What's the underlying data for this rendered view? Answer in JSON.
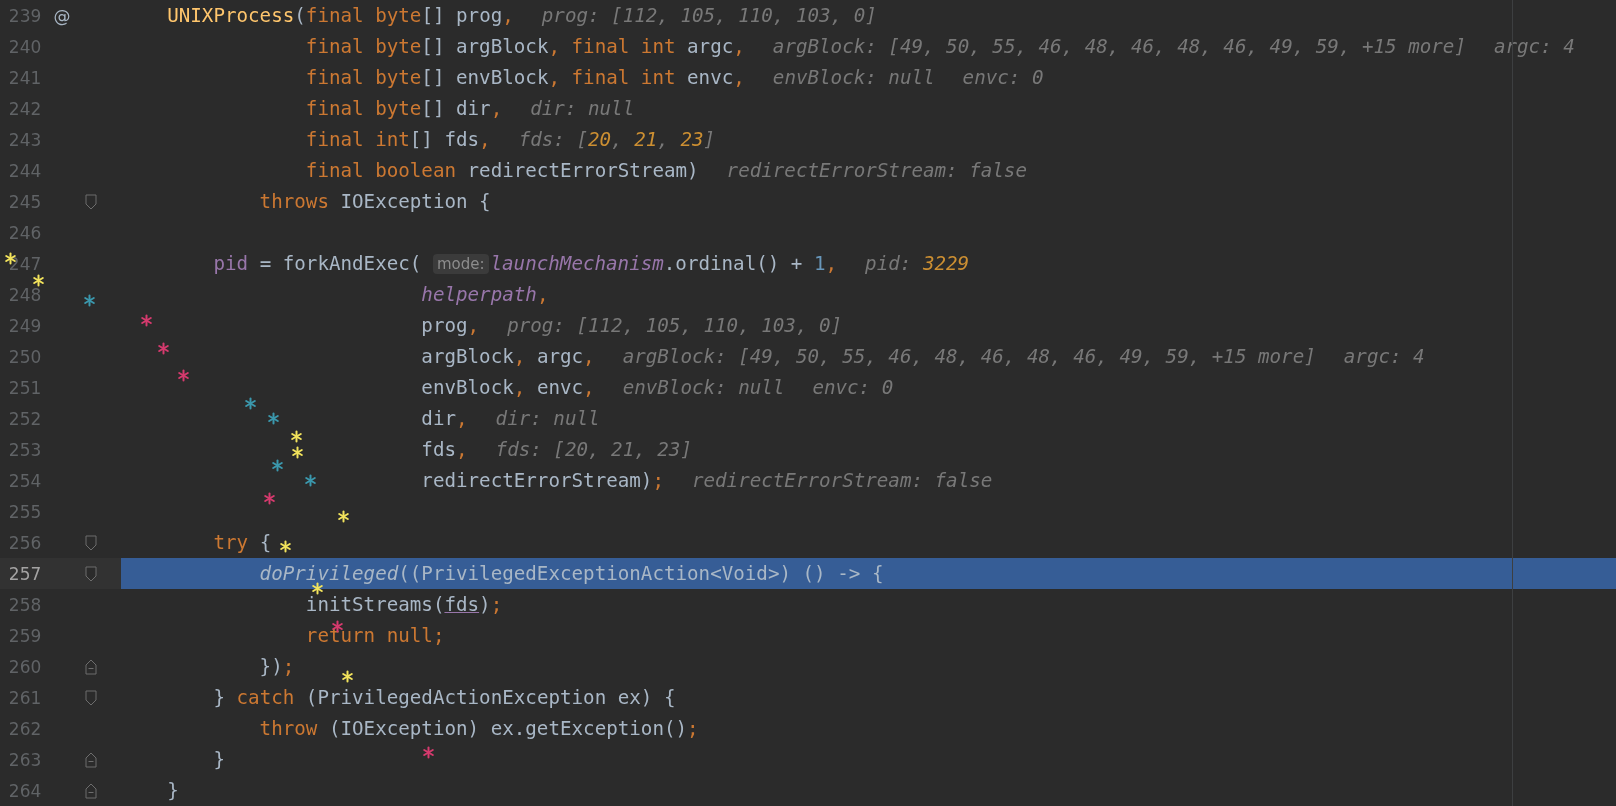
{
  "editor": {
    "lines": [
      {
        "number": "239",
        "selected": false,
        "gutter_mark": "@",
        "code": [
          {
            "kind": "decl",
            "text": "    UNIXProcess"
          },
          {
            "kind": "plain",
            "text": "("
          },
          {
            "kind": "kw",
            "text": "final byte"
          },
          {
            "kind": "plain",
            "text": "[] prog"
          },
          {
            "kind": "kw",
            "text": ","
          }
        ],
        "hints": [
          {
            "segments": [
              {
                "kind": "label",
                "text": "prog: [112, 105, 110, 103, 0]"
              }
            ]
          }
        ]
      },
      {
        "number": "240",
        "selected": false,
        "code": [
          {
            "kind": "kw",
            "text": "                final byte"
          },
          {
            "kind": "plain",
            "text": "[] argBlock"
          },
          {
            "kind": "kw",
            "text": ", final int "
          },
          {
            "kind": "plain",
            "text": "argc"
          },
          {
            "kind": "kw",
            "text": ","
          }
        ],
        "hints": [
          {
            "segments": [
              {
                "kind": "label",
                "text": "argBlock: [49, 50, 55, 46, 48, 46, 48, 46, 49, 59, +15 more]"
              }
            ]
          },
          {
            "segments": [
              {
                "kind": "label",
                "text": "argc: 4"
              }
            ]
          }
        ]
      },
      {
        "number": "241",
        "selected": false,
        "code": [
          {
            "kind": "kw",
            "text": "                final byte"
          },
          {
            "kind": "plain",
            "text": "[] envBlock"
          },
          {
            "kind": "kw",
            "text": ", final int "
          },
          {
            "kind": "plain",
            "text": "envc"
          },
          {
            "kind": "kw",
            "text": ","
          }
        ],
        "hints": [
          {
            "segments": [
              {
                "kind": "label",
                "text": "envBlock: null"
              }
            ]
          },
          {
            "segments": [
              {
                "kind": "label",
                "text": "envc: 0"
              }
            ]
          }
        ]
      },
      {
        "number": "242",
        "selected": false,
        "code": [
          {
            "kind": "kw",
            "text": "                final byte"
          },
          {
            "kind": "plain",
            "text": "[] dir"
          },
          {
            "kind": "kw",
            "text": ","
          }
        ],
        "hints": [
          {
            "segments": [
              {
                "kind": "label",
                "text": "dir: null"
              }
            ]
          }
        ]
      },
      {
        "number": "243",
        "selected": false,
        "code": [
          {
            "kind": "kw",
            "text": "                final int"
          },
          {
            "kind": "plain",
            "text": "[] fds"
          },
          {
            "kind": "kw",
            "text": ","
          }
        ],
        "hints": [
          {
            "segments": [
              {
                "kind": "label",
                "text": "fds: ["
              },
              {
                "kind": "value",
                "text": "20"
              },
              {
                "kind": "label",
                "text": ", "
              },
              {
                "kind": "value",
                "text": "21"
              },
              {
                "kind": "label",
                "text": ", "
              },
              {
                "kind": "value",
                "text": "23"
              },
              {
                "kind": "label",
                "text": "]"
              }
            ]
          }
        ]
      },
      {
        "number": "244",
        "selected": false,
        "code": [
          {
            "kind": "kw",
            "text": "                final boolean "
          },
          {
            "kind": "plain",
            "text": "redirectErrorStream)"
          }
        ],
        "hints": [
          {
            "segments": [
              {
                "kind": "label",
                "text": "redirectErrorStream: false"
              }
            ]
          }
        ]
      },
      {
        "number": "245",
        "selected": false,
        "fold": {
          "kind": "start"
        },
        "code": [
          {
            "kind": "kw",
            "text": "            throws "
          },
          {
            "kind": "plain",
            "text": "IOException {"
          }
        ]
      },
      {
        "number": "246",
        "selected": false
      },
      {
        "number": "247",
        "selected": false,
        "code": [
          {
            "kind": "member",
            "text": "        pid"
          },
          {
            "kind": "plain",
            "text": " = forkAndExec( "
          },
          {
            "kind": "inlay",
            "text": "mode:"
          },
          {
            "kind": "field",
            "text": "launchMechanism"
          },
          {
            "kind": "plain",
            "text": ".ordinal() + "
          },
          {
            "kind": "num",
            "text": "1"
          },
          {
            "kind": "kw",
            "text": ","
          }
        ],
        "hints": [
          {
            "segments": [
              {
                "kind": "label",
                "text": "pid: "
              },
              {
                "kind": "value",
                "text": "3229"
              }
            ]
          }
        ]
      },
      {
        "number": "248",
        "selected": false,
        "code": [
          {
            "kind": "field",
            "text": "                          helperpath"
          },
          {
            "kind": "kw",
            "text": ","
          }
        ]
      },
      {
        "number": "249",
        "selected": false,
        "code": [
          {
            "kind": "plain",
            "text": "                          prog"
          },
          {
            "kind": "kw",
            "text": ","
          }
        ],
        "hints": [
          {
            "segments": [
              {
                "kind": "label",
                "text": "prog: [112, 105, 110, 103, 0]"
              }
            ]
          }
        ]
      },
      {
        "number": "250",
        "selected": false,
        "code": [
          {
            "kind": "plain",
            "text": "                          argBlock"
          },
          {
            "kind": "kw",
            "text": ", "
          },
          {
            "kind": "plain",
            "text": "argc"
          },
          {
            "kind": "kw",
            "text": ","
          }
        ],
        "hints": [
          {
            "segments": [
              {
                "kind": "label",
                "text": "argBlock: [49, 50, 55, 46, 48, 46, 48, 46, 49, 59, +15 more]"
              }
            ]
          },
          {
            "segments": [
              {
                "kind": "label",
                "text": "argc: 4"
              }
            ]
          }
        ]
      },
      {
        "number": "251",
        "selected": false,
        "code": [
          {
            "kind": "plain",
            "text": "                          envBlock"
          },
          {
            "kind": "kw",
            "text": ", "
          },
          {
            "kind": "plain",
            "text": "envc"
          },
          {
            "kind": "kw",
            "text": ","
          }
        ],
        "hints": [
          {
            "segments": [
              {
                "kind": "label",
                "text": "envBlock: null"
              }
            ]
          },
          {
            "segments": [
              {
                "kind": "label",
                "text": "envc: 0"
              }
            ]
          }
        ]
      },
      {
        "number": "252",
        "selected": false,
        "code": [
          {
            "kind": "plain",
            "text": "                          dir"
          },
          {
            "kind": "kw",
            "text": ","
          }
        ],
        "hints": [
          {
            "segments": [
              {
                "kind": "label",
                "text": "dir: null"
              }
            ]
          }
        ]
      },
      {
        "number": "253",
        "selected": false,
        "code": [
          {
            "kind": "plain",
            "text": "                          fds"
          },
          {
            "kind": "kw",
            "text": ","
          }
        ],
        "hints": [
          {
            "segments": [
              {
                "kind": "label",
                "text": "fds: [20, 21, 23]"
              }
            ]
          }
        ]
      },
      {
        "number": "254",
        "selected": false,
        "code": [
          {
            "kind": "plain",
            "text": "                          redirectErrorStream)"
          },
          {
            "kind": "kw",
            "text": ";"
          }
        ],
        "hints": [
          {
            "segments": [
              {
                "kind": "label",
                "text": "redirectErrorStream: false"
              }
            ]
          }
        ]
      },
      {
        "number": "255",
        "selected": false
      },
      {
        "number": "256",
        "selected": false,
        "fold": {
          "kind": "start"
        },
        "code": [
          {
            "kind": "kw",
            "text": "        try "
          },
          {
            "kind": "plain",
            "text": "{"
          }
        ]
      },
      {
        "number": "257",
        "selected": true,
        "fold": {
          "kind": "start"
        },
        "code": [
          {
            "kind": "call",
            "text": "            doPrivileged"
          },
          {
            "kind": "plain",
            "text": "((PrivilegedExceptionAction<Void>) () -> {"
          }
        ]
      },
      {
        "number": "258",
        "selected": false,
        "code": [
          {
            "kind": "plain",
            "text": "                initStreams("
          },
          {
            "kind": "link",
            "text": "fds"
          },
          {
            "kind": "plain",
            "text": ")"
          },
          {
            "kind": "kw",
            "text": ";"
          }
        ]
      },
      {
        "number": "259",
        "selected": false,
        "code": [
          {
            "kind": "kw",
            "text": "                return null;"
          }
        ]
      },
      {
        "number": "260",
        "selected": false,
        "fold": {
          "kind": "end"
        },
        "code": [
          {
            "kind": "plain",
            "text": "            })"
          },
          {
            "kind": "kw",
            "text": ";"
          }
        ]
      },
      {
        "number": "261",
        "selected": false,
        "fold": {
          "kind": "start"
        },
        "code": [
          {
            "kind": "plain",
            "text": "        } "
          },
          {
            "kind": "kw",
            "text": "catch "
          },
          {
            "kind": "plain",
            "text": "(PrivilegedActionException ex) {"
          }
        ]
      },
      {
        "number": "262",
        "selected": false,
        "code": [
          {
            "kind": "kw",
            "text": "            throw "
          },
          {
            "kind": "plain",
            "text": "(IOException) ex.getException()"
          },
          {
            "kind": "kw",
            "text": ";"
          }
        ]
      },
      {
        "number": "263",
        "selected": false,
        "fold": {
          "kind": "end"
        },
        "code": [
          {
            "kind": "plain",
            "text": "        }"
          }
        ]
      },
      {
        "number": "264",
        "selected": false,
        "fold": {
          "kind": "end"
        },
        "code": [
          {
            "kind": "plain",
            "text": "    }"
          }
        ]
      }
    ]
  },
  "sparkles": [
    {
      "color": "#f2e35c"
    },
    {
      "color": "#f2e35c"
    },
    {
      "color": "#3b98ad"
    },
    {
      "color": "#d63a6e"
    },
    {
      "color": "#d63a6e"
    },
    {
      "color": "#d63a6e"
    },
    {
      "color": "#3b98ad"
    },
    {
      "color": "#3b98ad"
    },
    {
      "color": "#f2e35c"
    },
    {
      "color": "#f2e35c"
    },
    {
      "color": "#3b98ad"
    },
    {
      "color": "#3b98ad"
    },
    {
      "color": "#d63a6e"
    },
    {
      "color": "#f2e35c"
    },
    {
      "color": "#f2e35c"
    },
    {
      "color": "#f2e35c"
    },
    {
      "color": "#d63a6e"
    },
    {
      "color": "#f2e35c"
    },
    {
      "color": "#d63a6e"
    }
  ]
}
